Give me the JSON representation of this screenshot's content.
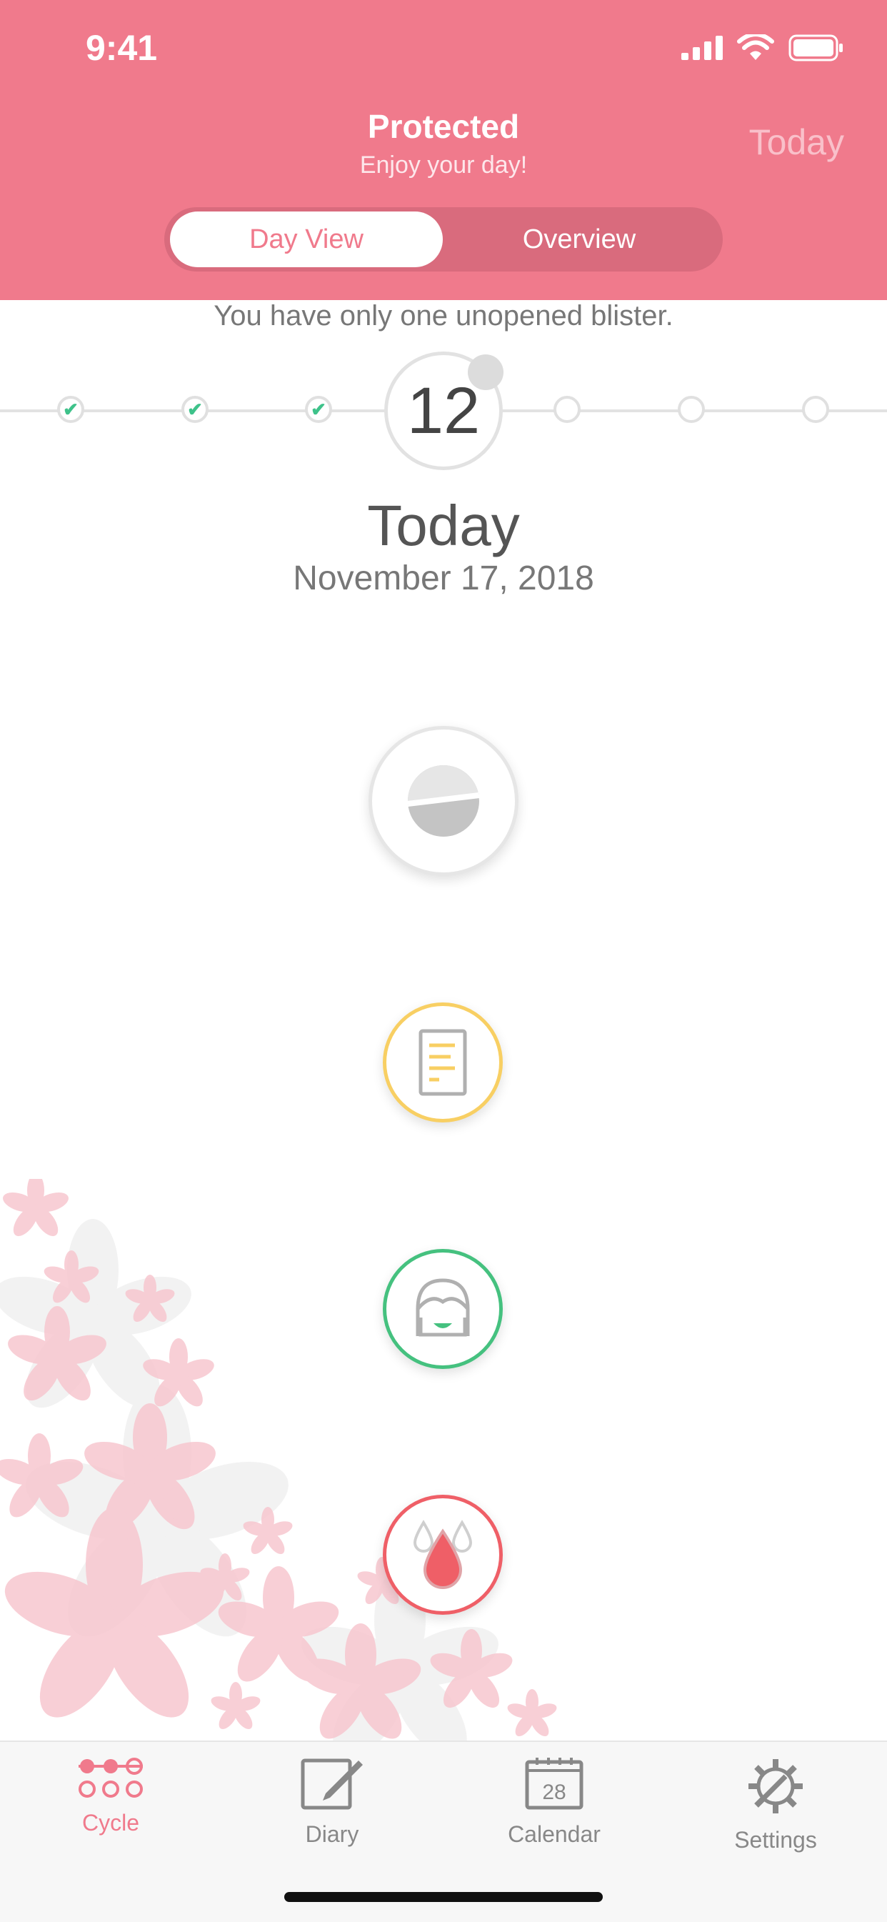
{
  "status_bar": {
    "time": "9:41"
  },
  "header": {
    "title": "Protected",
    "subtitle": "Enjoy your day!",
    "today_link": "Today",
    "segments": {
      "day_view": "Day View",
      "overview": "Overview"
    }
  },
  "info_text": "You have only one unopened blister.",
  "timeline": {
    "current_day": "12"
  },
  "today": {
    "label": "Today",
    "date": "November 17, 2018"
  },
  "tabbar": {
    "cycle": "Cycle",
    "diary": "Diary",
    "calendar": "Calendar",
    "calendar_day": "28",
    "settings": "Settings"
  },
  "colors": {
    "brand": "#f07a8c",
    "check": "#3ec28a",
    "notes": "#f8cf63",
    "mood": "#45c17f",
    "bleeding": "#ef5f67"
  }
}
